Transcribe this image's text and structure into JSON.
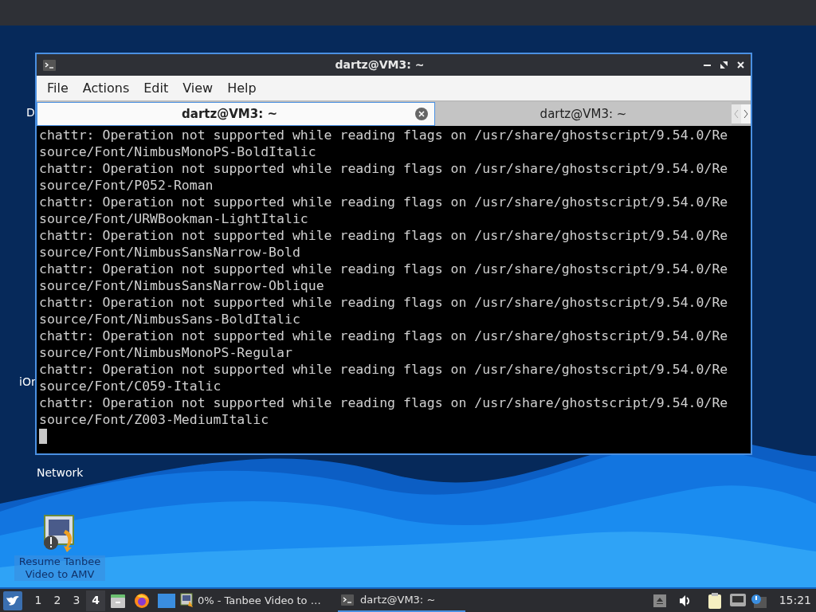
{
  "desktop_icons": [
    {
      "label": "D",
      "kind": "cut"
    },
    {
      "label": "iOr",
      "kind": "cut"
    },
    {
      "label": "Network",
      "kind": "label"
    },
    {
      "label": "Resume Tanbee Video to AMV",
      "kind": "app"
    }
  ],
  "window": {
    "title": "dartz@VM3: ~",
    "menu": [
      "File",
      "Actions",
      "Edit",
      "View",
      "Help"
    ],
    "tabs": [
      {
        "label": "dartz@VM3: ~",
        "selected": true
      },
      {
        "label": "dartz@VM3: ~",
        "selected": false
      }
    ],
    "terminal_lines": [
      "chattr: Operation not supported while reading flags on /usr/share/ghostscript/9.54.0/Re",
      "source/Font/NimbusMonoPS-BoldItalic",
      "chattr: Operation not supported while reading flags on /usr/share/ghostscript/9.54.0/Re",
      "source/Font/P052-Roman",
      "chattr: Operation not supported while reading flags on /usr/share/ghostscript/9.54.0/Re",
      "source/Font/URWBookman-LightItalic",
      "chattr: Operation not supported while reading flags on /usr/share/ghostscript/9.54.0/Re",
      "source/Font/NimbusSansNarrow-Bold",
      "chattr: Operation not supported while reading flags on /usr/share/ghostscript/9.54.0/Re",
      "source/Font/NimbusSansNarrow-Oblique",
      "chattr: Operation not supported while reading flags on /usr/share/ghostscript/9.54.0/Re",
      "source/Font/NimbusSans-BoldItalic",
      "chattr: Operation not supported while reading flags on /usr/share/ghostscript/9.54.0/Re",
      "source/Font/NimbusMonoPS-Regular",
      "chattr: Operation not supported while reading flags on /usr/share/ghostscript/9.54.0/Re",
      "source/Font/C059-Italic",
      "chattr: Operation not supported while reading flags on /usr/share/ghostscript/9.54.0/Re",
      "source/Font/Z003-MediumItalic"
    ]
  },
  "taskbar": {
    "workspaces": [
      {
        "label": "1",
        "selected": false
      },
      {
        "label": "2",
        "selected": false
      },
      {
        "label": "3",
        "selected": false
      },
      {
        "label": "4",
        "selected": true
      }
    ],
    "tasks": [
      {
        "label": "0% - Tanbee Video to …",
        "kind": "app",
        "selected": false
      },
      {
        "label": "dartz@VM3: ~",
        "kind": "terminal",
        "selected": true
      }
    ],
    "clock": "15:21"
  }
}
